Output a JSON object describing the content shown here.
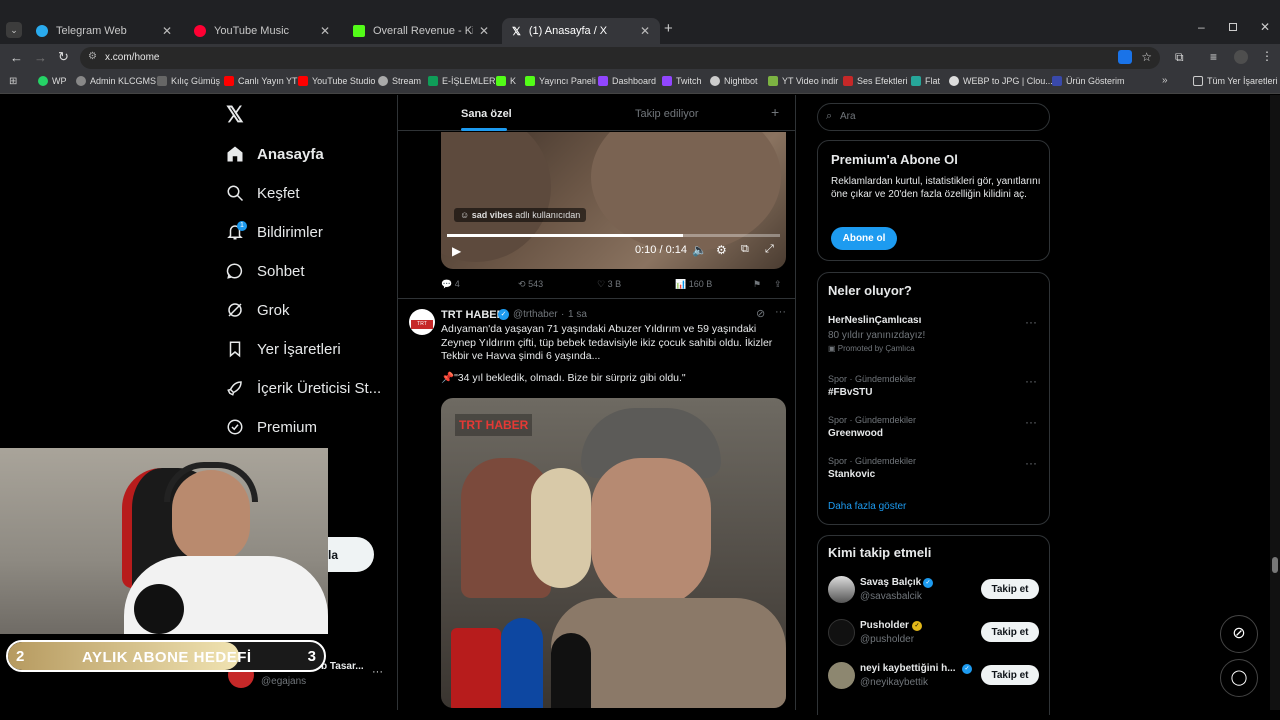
{
  "browser": {
    "tabs": [
      {
        "title": "Telegram Web",
        "color": "#2aabee"
      },
      {
        "title": "YouTube Music",
        "color": "#ff0033"
      },
      {
        "title": "Overall Revenue - Kick Dashboard",
        "color": "#53fc18"
      },
      {
        "title": "(1) Anasayfa / X",
        "color": "#ffffff"
      }
    ],
    "url": "x.com/home",
    "bookmarks": [
      "WP",
      "Admin KLCGMS",
      "Kılıç Gümüş",
      "Canlı Yayın YT",
      "YouTube Studio",
      "Stream",
      "E-İŞLEMLER",
      "K",
      "Yayıncı Paneli",
      "Dashboard",
      "Twitch",
      "Nightbot",
      "YT Video indir",
      "Ses Efektleri",
      "Flat",
      "WEBP to JPG | Clou...",
      "Ürün Gösterim",
      "Tüm Yer İşaretleri"
    ]
  },
  "sidebar": {
    "items": [
      {
        "label": "Anasayfa",
        "icon": "home-icon"
      },
      {
        "label": "Keşfet",
        "icon": "search-icon"
      },
      {
        "label": "Bildirimler",
        "icon": "bell-icon",
        "badge": "1"
      },
      {
        "label": "Sohbet",
        "icon": "chat-icon"
      },
      {
        "label": "Grok",
        "icon": "grok-icon"
      },
      {
        "label": "Yer İşaretleri",
        "icon": "bookmark-icon"
      },
      {
        "label": "İçerik Üreticisi St...",
        "icon": "rocket-icon"
      },
      {
        "label": "Premium",
        "icon": "premium-icon"
      }
    ],
    "post_button": "la",
    "account": {
      "name": "Eg Ajans Web Tasar...",
      "handle": "@egajans",
      "more": "···"
    }
  },
  "overlay": {
    "goal_start": "2",
    "goal_label": "AYLIK ABONE HEDEFİ",
    "goal_end": "3",
    "goal_progress": 0.73
  },
  "feed": {
    "tabs": [
      "Sana özel",
      "Takip ediliyor"
    ],
    "add": "+",
    "video": {
      "caption_user": "sad vibes",
      "caption_rest": "adlı kullanıcıdan",
      "time": "0:10 / 0:14",
      "progress": 0.71
    },
    "actions": {
      "replies": "4",
      "reposts": "543",
      "likes": "3 B",
      "views": "160 B"
    },
    "tweet": {
      "name": "TRT HABER",
      "handle": "@trthaber",
      "time": "1 sa",
      "avatar_text": "TRT\nHABER",
      "text": "Adıyaman'da yaşayan 71 yaşındaki Abuzer Yıldırım ve 59 yaşındaki Zeynep Yıldırım çifti, tüp bebek tedavisiyle ikiz çocuk sahibi oldu. İkizler Tekbir ve Havva şimdi 6 yaşında...",
      "quote": "\"34 yıl bekledik, olmadı. Bize bir sürpriz gibi oldu.\"",
      "image_logo": "TRT HABER"
    }
  },
  "right": {
    "search_placeholder": "Ara",
    "premium": {
      "title": "Premium'a Abone Ol",
      "text": "Reklamlardan kurtul, istatistikleri gör, yanıtlarını öne çıkar ve 20'den fazla özelliğin kilidini aç.",
      "button": "Abone ol"
    },
    "trends_title": "Neler oluyor?",
    "trends": [
      {
        "meta": "",
        "title": "HerNeslinÇamlıcası",
        "sub": "80 yıldır yanınızdayız!",
        "promo": "Promoted by Çamlıca"
      },
      {
        "meta": "Spor · Gündemdekiler",
        "title": "#FBvSTU"
      },
      {
        "meta": "Spor · Gündemdekiler",
        "title": "Greenwood"
      },
      {
        "meta": "Spor · Gündemdekiler",
        "title": "Stankovic"
      }
    ],
    "show_more": "Daha fazla göster",
    "who_title": "Kimi takip etmeli",
    "who": [
      {
        "name": "Savaş Balçık",
        "handle": "@savasbalcik",
        "button": "Takip et",
        "verified": "#1d9bf0"
      },
      {
        "name": "Pusholder",
        "handle": "@pusholder",
        "button": "Takip et",
        "verified": "#e2b719"
      },
      {
        "name": "neyi kaybettiğini h...",
        "handle": "@neyikaybettik",
        "button": "Takip et",
        "verified": "#1d9bf0"
      }
    ]
  },
  "colors": {
    "accent": "#1d9bf0",
    "bg": "#000000",
    "border": "#2f3336",
    "muted": "#71767b"
  }
}
